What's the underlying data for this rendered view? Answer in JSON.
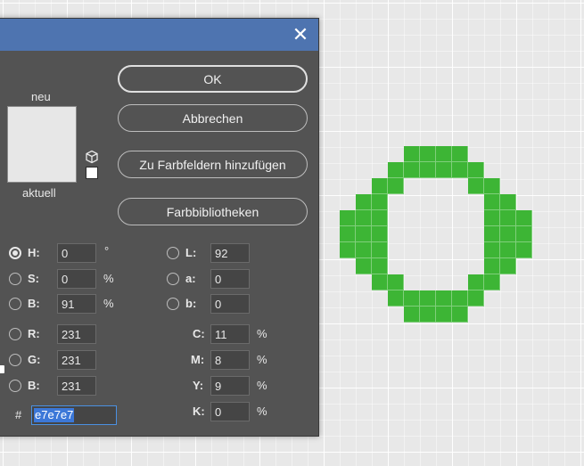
{
  "dialog": {
    "close_glyph": "✕",
    "labels": {
      "new": "neu",
      "current": "aktuell"
    },
    "swatch_color": "#e7e7e7",
    "buttons": {
      "ok": "OK",
      "cancel": "Abbrechen",
      "add_to_swatches": "Zu Farbfeldern hinzufügen",
      "color_libraries": "Farbbibliotheken"
    },
    "hsb": {
      "h": {
        "label": "H:",
        "value": "0",
        "unit": "°"
      },
      "s": {
        "label": "S:",
        "value": "0",
        "unit": "%"
      },
      "b": {
        "label": "B:",
        "value": "91",
        "unit": "%"
      }
    },
    "lab": {
      "l": {
        "label": "L:",
        "value": "92"
      },
      "a": {
        "label": "a:",
        "value": "0"
      },
      "b": {
        "label": "b:",
        "value": "0"
      }
    },
    "rgb": {
      "r": {
        "label": "R:",
        "value": "231"
      },
      "g": {
        "label": "G:",
        "value": "231"
      },
      "b": {
        "label": "B:",
        "value": "231"
      }
    },
    "cmyk": {
      "c": {
        "label": "C:",
        "value": "11",
        "unit": "%"
      },
      "m": {
        "label": "M:",
        "value": "8",
        "unit": "%"
      },
      "y": {
        "label": "Y:",
        "value": "9",
        "unit": "%"
      },
      "k": {
        "label": "K:",
        "value": "0",
        "unit": "%"
      }
    },
    "hex": {
      "label": "#",
      "value": "e7e7e7"
    }
  },
  "canvas": {
    "ring_color": "#3db535"
  }
}
